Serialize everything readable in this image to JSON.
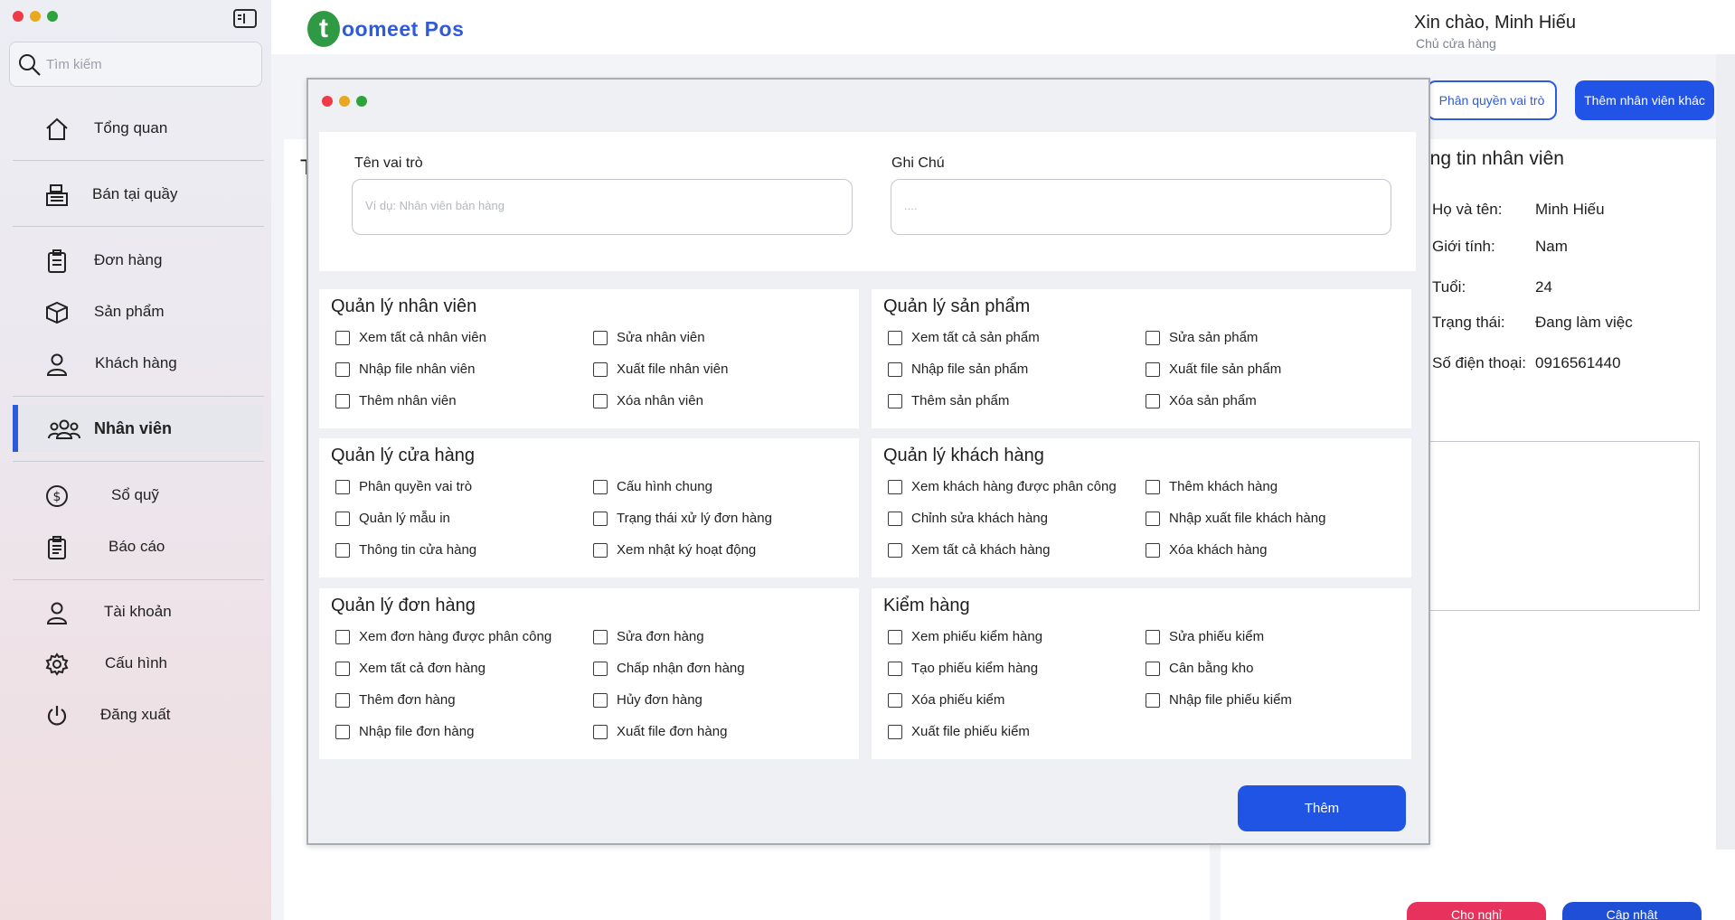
{
  "search": {
    "placeholder": "Tìm kiếm"
  },
  "sidebar": {
    "items": [
      {
        "label": "Tổng quan",
        "icon": "home-icon"
      },
      {
        "label": "Bán tại quầy",
        "icon": "pos-register-icon"
      },
      {
        "label": "Đơn hàng",
        "icon": "clipboard-icon"
      },
      {
        "label": "Sản phẩm",
        "icon": "box-icon"
      },
      {
        "label": "Khách hàng",
        "icon": "user-icon"
      },
      {
        "label": "Nhân viên",
        "icon": "users-icon",
        "active": true
      },
      {
        "label": "Sổ quỹ",
        "icon": "dollar-icon"
      },
      {
        "label": "Báo cáo",
        "icon": "report-icon"
      },
      {
        "label": "Tài khoản",
        "icon": "user-icon"
      },
      {
        "label": "Cấu hình",
        "icon": "gear-icon"
      },
      {
        "label": "Đăng xuất",
        "icon": "power-icon"
      }
    ]
  },
  "header": {
    "logo_letter": "t",
    "logo_text": "oomeet Pos",
    "greeting": "Xin chào, Minh Hiếu",
    "role": "Chủ cửa hàng"
  },
  "background": {
    "left_title": "T",
    "btn_role": "Phân quyền vai trò",
    "btn_add_staff": "Thêm nhân viên khác",
    "info_title": "ông tin nhân viên",
    "info": [
      {
        "key": "Họ và tên:",
        "value": "Minh Hiếu"
      },
      {
        "key": "Giới tính:",
        "value": "Nam"
      },
      {
        "key": "Tuổi:",
        "value": "24"
      },
      {
        "key": "Trạng thái:",
        "value": "Đang làm việc"
      },
      {
        "key": "Số điện thoại:",
        "value": "0916561440"
      }
    ],
    "btn_pink": "Cho nghỉ",
    "btn_blue": "Cập nhật"
  },
  "modal": {
    "role_name_label": "Tên vai trò",
    "role_name_placeholder": "Ví dụ: Nhân viên bán hàng",
    "note_label": "Ghi Chú",
    "note_placeholder": "....",
    "submit": "Thêm",
    "sections": [
      {
        "title": "Quản lý nhân viên",
        "left": [
          "Xem tất cả nhân viên",
          "Nhập file nhân viên",
          "Thêm nhân viên"
        ],
        "right": [
          "Sửa nhân viên",
          "Xuất file nhân viên",
          "Xóa nhân viên"
        ]
      },
      {
        "title": "Quản lý sản phẩm",
        "left": [
          "Xem tất cả sản phẩm",
          "Nhập file sản phẩm",
          "Thêm sản phẩm"
        ],
        "right": [
          "Sửa sản phẩm",
          "Xuất file sản phẩm",
          "Xóa sản phẩm"
        ]
      },
      {
        "title": "Quản lý cửa hàng",
        "left": [
          "Phân quyền vai trò",
          "Quản lý mẫu in",
          "Thông tin cửa hàng"
        ],
        "right": [
          "Cấu hình chung",
          "Trạng thái xử lý đơn hàng",
          "Xem nhật ký hoạt động"
        ]
      },
      {
        "title": "Quản lý khách hàng",
        "left": [
          "Xem khách hàng được phân công",
          "Chỉnh sửa khách hàng",
          "Xem tất cả khách hàng"
        ],
        "right": [
          "Thêm khách hàng",
          "Nhập xuất file khách hàng",
          "Xóa khách hàng"
        ]
      },
      {
        "title": "Quản lý đơn hàng",
        "left": [
          "Xem đơn hàng được phân công",
          "Xem tất cả đơn hàng",
          "Thêm đơn hàng",
          "Nhập file đơn hàng"
        ],
        "right": [
          "Sửa đơn hàng",
          "Chấp nhận đơn hàng",
          "Hủy đơn hàng",
          "Xuất file đơn hàng"
        ]
      },
      {
        "title": "Kiểm hàng",
        "left": [
          "Xem phiếu kiểm hàng",
          "Tạo phiếu kiểm hàng",
          "Xóa phiếu kiểm",
          "Xuất file phiếu kiểm"
        ],
        "right": [
          "Sửa phiếu kiểm",
          "Cân bằng kho",
          "Nhập file phiếu kiểm"
        ]
      }
    ]
  }
}
